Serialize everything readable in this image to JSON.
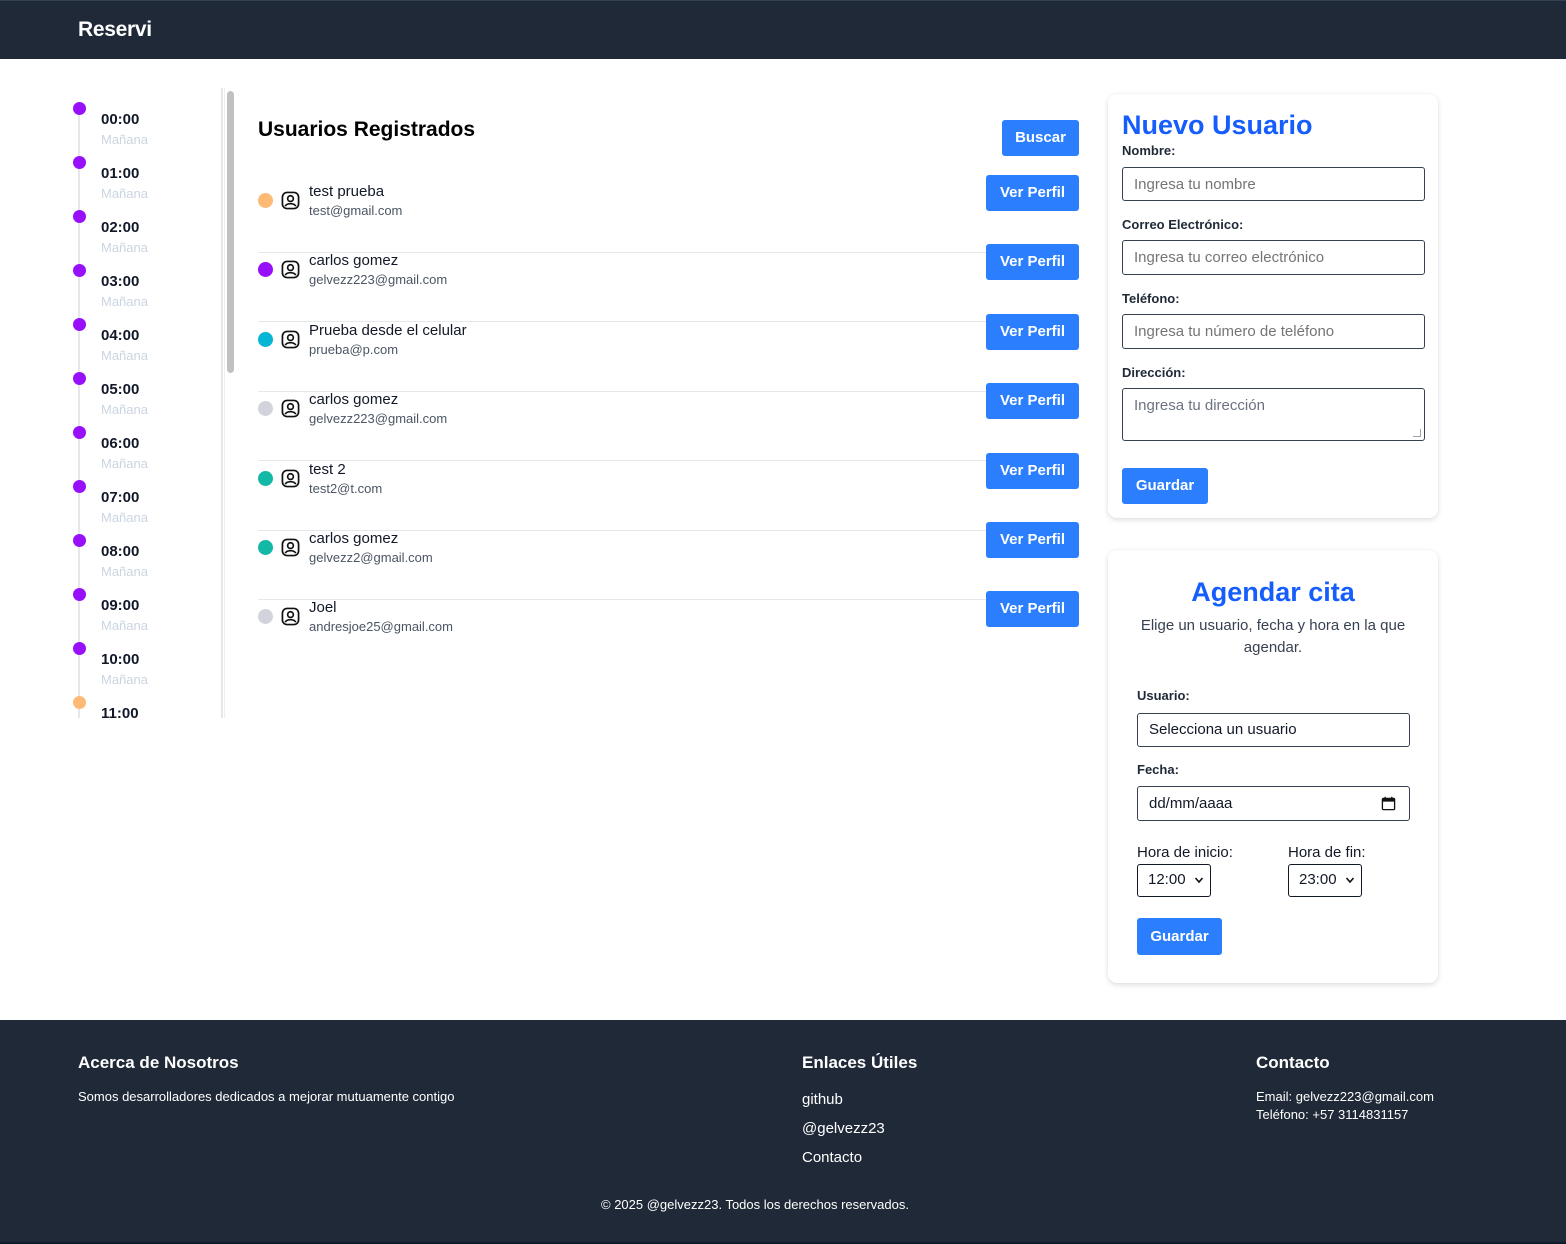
{
  "header": {
    "brand": "Reservi"
  },
  "timeline": {
    "items": [
      {
        "time": "00:00",
        "label": "Mañana",
        "color": "#9810fa"
      },
      {
        "time": "01:00",
        "label": "Mañana",
        "color": "#9810fa"
      },
      {
        "time": "02:00",
        "label": "Mañana",
        "color": "#9810fa"
      },
      {
        "time": "03:00",
        "label": "Mañana",
        "color": "#9810fa"
      },
      {
        "time": "04:00",
        "label": "Mañana",
        "color": "#9810fa"
      },
      {
        "time": "05:00",
        "label": "Mañana",
        "color": "#9810fa"
      },
      {
        "time": "06:00",
        "label": "Mañana",
        "color": "#9810fa"
      },
      {
        "time": "07:00",
        "label": "Mañana",
        "color": "#9810fa"
      },
      {
        "time": "08:00",
        "label": "Mañana",
        "color": "#9810fa"
      },
      {
        "time": "09:00",
        "label": "Mañana",
        "color": "#9810fa"
      },
      {
        "time": "10:00",
        "label": "Mañana",
        "color": "#9810fa"
      },
      {
        "time": "11:00",
        "label": "Mañana",
        "color": "#fdba74"
      }
    ]
  },
  "users": {
    "title": "Usuarios Registrados",
    "search_label": "Buscar",
    "profile_label": "Ver Perfil",
    "list": [
      {
        "name": "test prueba",
        "email": "test@gmail.com",
        "color": "#fdba74"
      },
      {
        "name": "carlos gomez",
        "email": "gelvezz223@gmail.com",
        "color": "#9810fa"
      },
      {
        "name": "Prueba desde el celular",
        "email": "prueba@p.com",
        "color": "#06b6d4"
      },
      {
        "name": "carlos gomez",
        "email": "gelvezz223@gmail.com",
        "color": "#d1d5db"
      },
      {
        "name": "test 2",
        "email": "test2@t.com",
        "color": "#14b8a6"
      },
      {
        "name": "carlos gomez",
        "email": "gelvezz2@gmail.com",
        "color": "#14b8a6"
      },
      {
        "name": "Joel",
        "email": "andresjoe25@gmail.com",
        "color": "#d1d5db"
      }
    ]
  },
  "new_user": {
    "title": "Nuevo Usuario",
    "name_label": "Nombre:",
    "name_placeholder": "Ingresa tu nombre",
    "email_label": "Correo Electrónico:",
    "email_placeholder": "Ingresa tu correo electrónico",
    "phone_label": "Teléfono:",
    "phone_placeholder": "Ingresa tu número de teléfono",
    "address_label": "Dirección:",
    "address_placeholder": "Ingresa tu dirección",
    "save_label": "Guardar"
  },
  "appointment": {
    "title": "Agendar cita",
    "subtitle": "Elige un usuario, fecha y hora en la que agendar.",
    "user_label": "Usuario:",
    "user_value": "Selecciona un usuario",
    "date_label": "Fecha:",
    "date_value": "dd/mm/aaaa",
    "start_label": "Hora de inicio:",
    "start_value": "12:00",
    "end_label": "Hora de fin:",
    "end_value": "23:00",
    "save_label": "Guardar"
  },
  "footer": {
    "about_title": "Acerca de Nosotros",
    "about_text": "Somos desarrolladores dedicados a mejorar mutuamente contigo",
    "links_title": "Enlaces Útiles",
    "links": [
      "github",
      "@gelvezz23",
      "Contacto"
    ],
    "contact_title": "Contacto",
    "contact_email": "Email: gelvezz223@gmail.com",
    "contact_phone": "Teléfono: +57 3114831157",
    "copyright": "© 2025 @gelvezz23. Todos los derechos reservados."
  },
  "colors": {
    "primary": "#2b7fff",
    "title_blue": "#155dfc",
    "dark_bg": "#1f2937"
  }
}
